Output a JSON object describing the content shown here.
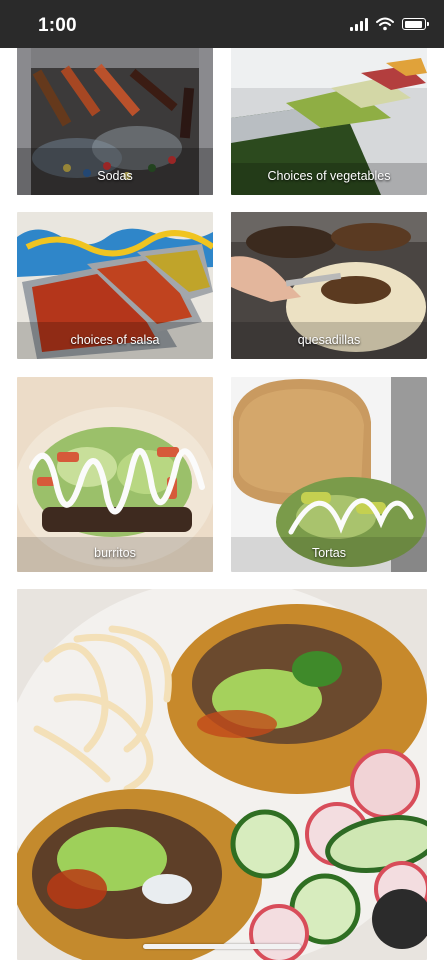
{
  "status_bar": {
    "time": "1:00"
  },
  "gallery": {
    "items": [
      {
        "label": "Sodas"
      },
      {
        "label": "Choices of vegetables"
      },
      {
        "label": "choices of salsa"
      },
      {
        "label": "quesadillas"
      },
      {
        "label": "burritos"
      },
      {
        "label": "Tortas"
      }
    ],
    "feature_image": "tacos-plate-photo"
  }
}
